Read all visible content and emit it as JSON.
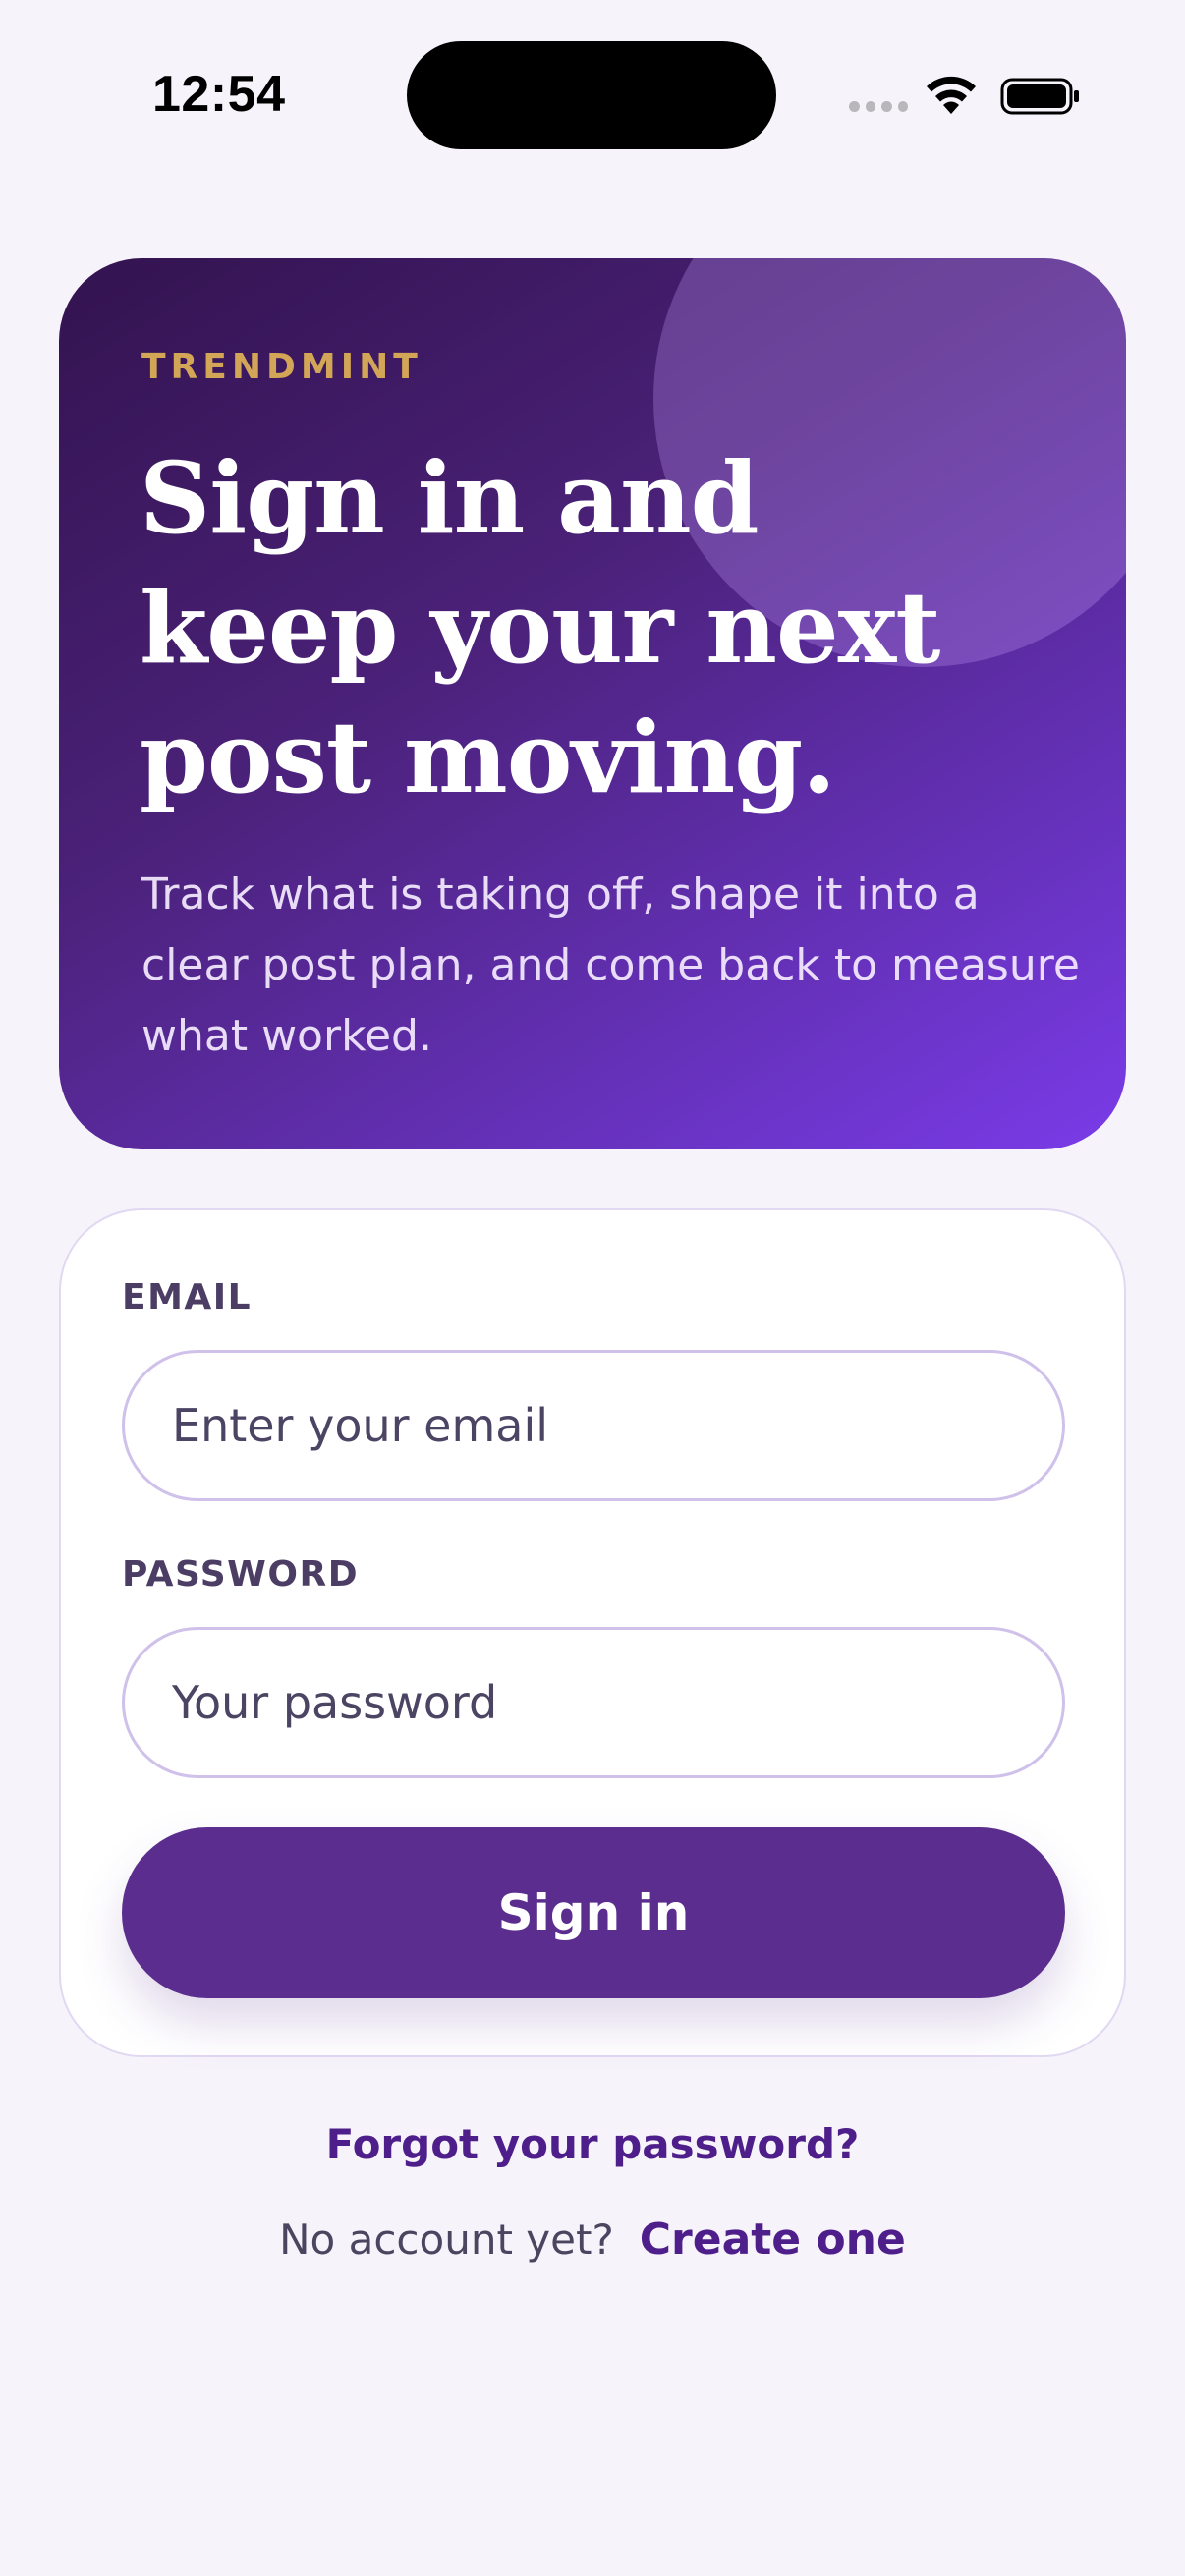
{
  "status_bar": {
    "time": "12:54",
    "icons": [
      "signal-icon",
      "wifi-icon",
      "battery-icon"
    ]
  },
  "hero": {
    "brand": "TRENDMINT",
    "title": "Sign in and keep your next post moving.",
    "subtitle": "Track what is taking off, shape it into a clear post plan, and come back to measure what worked."
  },
  "form": {
    "email_label": "EMAIL",
    "email_placeholder": "Enter your email",
    "email_value": "",
    "password_label": "PASSWORD",
    "password_placeholder": "Your password",
    "password_value": "",
    "submit_label": "Sign in"
  },
  "links": {
    "forgot_password": "Forgot your password?",
    "signup_prompt": "No account yet?",
    "signup_link": "Create one"
  },
  "colors": {
    "background": "#f6f3fa",
    "hero_gradient_start": "#33134f",
    "hero_gradient_end": "#7a3be8",
    "brand_gold": "#d2a656",
    "button": "#5a2d8e",
    "link": "#4e1f8a"
  }
}
